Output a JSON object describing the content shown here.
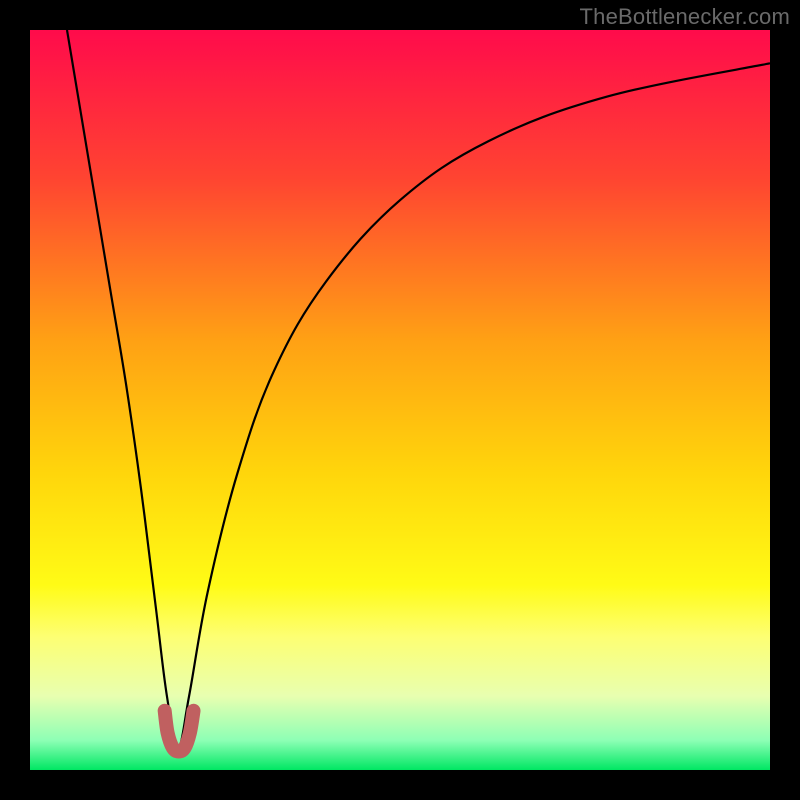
{
  "attribution": "TheBottlenecker.com",
  "chart_data": {
    "type": "line",
    "title": "",
    "xlabel": "",
    "ylabel": "",
    "xlim": [
      0,
      100
    ],
    "ylim": [
      0,
      100
    ],
    "gradient_stops": [
      {
        "offset": 0.0,
        "color": "#ff0b4b"
      },
      {
        "offset": 0.2,
        "color": "#ff4431"
      },
      {
        "offset": 0.42,
        "color": "#ffa114"
      },
      {
        "offset": 0.6,
        "color": "#ffd60b"
      },
      {
        "offset": 0.75,
        "color": "#fffb16"
      },
      {
        "offset": 0.82,
        "color": "#fdff73"
      },
      {
        "offset": 0.9,
        "color": "#e8ffb0"
      },
      {
        "offset": 0.96,
        "color": "#8dffb5"
      },
      {
        "offset": 1.0,
        "color": "#00e763"
      }
    ],
    "series": [
      {
        "name": "bottleneck-curve",
        "x_min_at": 20,
        "points": [
          {
            "x": 5.0,
            "y": 100.0
          },
          {
            "x": 7.0,
            "y": 88.0
          },
          {
            "x": 9.0,
            "y": 76.0
          },
          {
            "x": 11.0,
            "y": 64.0
          },
          {
            "x": 13.0,
            "y": 52.0
          },
          {
            "x": 15.0,
            "y": 38.0
          },
          {
            "x": 17.0,
            "y": 22.0
          },
          {
            "x": 18.5,
            "y": 10.0
          },
          {
            "x": 20.0,
            "y": 3.0
          },
          {
            "x": 21.5,
            "y": 10.0
          },
          {
            "x": 24.0,
            "y": 24.0
          },
          {
            "x": 28.0,
            "y": 40.0
          },
          {
            "x": 33.0,
            "y": 54.0
          },
          {
            "x": 40.0,
            "y": 66.0
          },
          {
            "x": 50.0,
            "y": 77.0
          },
          {
            "x": 62.0,
            "y": 85.0
          },
          {
            "x": 78.0,
            "y": 91.0
          },
          {
            "x": 100.0,
            "y": 95.5
          }
        ]
      }
    ],
    "marker": {
      "name": "highlight-region",
      "color": "#c06060",
      "points": [
        {
          "x": 18.2,
          "y": 8.0
        },
        {
          "x": 18.6,
          "y": 5.0
        },
        {
          "x": 19.3,
          "y": 3.0
        },
        {
          "x": 20.1,
          "y": 2.5
        },
        {
          "x": 20.9,
          "y": 3.0
        },
        {
          "x": 21.6,
          "y": 5.0
        },
        {
          "x": 22.1,
          "y": 8.0
        }
      ]
    }
  }
}
